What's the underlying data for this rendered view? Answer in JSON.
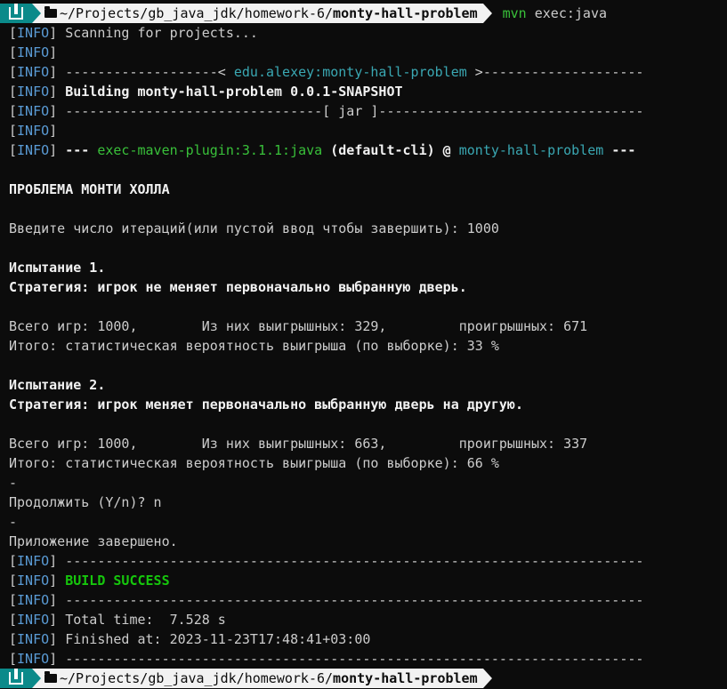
{
  "prompt": {
    "path_prefix": "~/Projects/gb_java_jdk/homework-6/",
    "path_dir": "monty-hall-problem",
    "cmd_name": "mvn",
    "cmd_args": " exec:java"
  },
  "info_tag": "INFO",
  "lines": {
    "scan": " Scanning for projects...",
    "coord_left": " -------------------< ",
    "coord_artifact": "edu.alexey:monty-hall-problem",
    "coord_right": " >--------------------",
    "building": " Building monty-hall-problem 0.0.1-SNAPSHOT",
    "jar": " --------------------------------[ jar ]---------------------------------",
    "plugin_dash": " --- ",
    "plugin_name": "exec-maven-plugin:3.1.1:java",
    "plugin_mid": " (default-cli) @ ",
    "plugin_project": "monty-hall-problem",
    "plugin_end": " ---",
    "title": "ПРОБЛЕМА МОНТИ ХОЛЛА",
    "iterations": "Введите число итераций(или пустой ввод чтобы завершить): 1000",
    "trial1": "Испытание 1.",
    "strategy1": "Стратегия: игрок не меняет первоначально выбранную дверь.",
    "totals1": "Всего игр: 1000,        Из них выигрышных: 329,         проигрышных: 671",
    "result1": "Итого: статистическая вероятность выигрыша (по выборке): 33 %",
    "trial2": "Испытание 2.",
    "strategy2": "Стратегия: игрок меняет первоначально выбранную дверь на другую.",
    "totals2": "Всего игр: 1000,        Из них выигрышных: 663,         проигрышных: 337",
    "result2": "Итого: статистическая вероятность выигрыша (по выборке): 66 %",
    "dash": "-",
    "continue": "Продолжить (Y/n)? n",
    "finished_app": "Приложение завершено.",
    "sep": " ------------------------------------------------------------------------",
    "build_success": "BUILD SUCCESS",
    "total_time": " Total time:  7.528 s",
    "finished_at": " Finished at: 2023-11-23T17:48:41+03:00"
  },
  "colors": {
    "background": "#0c0c0c",
    "info": "#5a9bd5",
    "teal": "#3aa8b3",
    "green": "#39c13a",
    "os_segment": "#0b8a8a",
    "path_segment": "#f2f2f2"
  },
  "icons": {
    "os": "manjaro-logo-icon",
    "folder": "folder-icon"
  }
}
